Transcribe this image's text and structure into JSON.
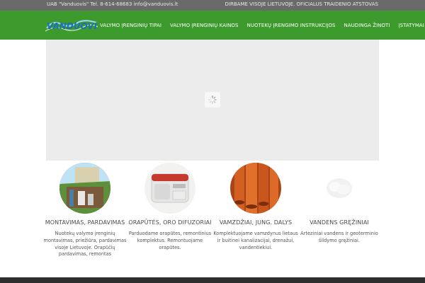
{
  "topbar": {
    "contact": "UAB \"Vanduovis\" Tel. 8-614-68683 info@vanduovis.lt",
    "tagline": "DIRBAME VISOJE LIETUVOJE. OFICIALUS TRAIDENIO ATSTOVAS"
  },
  "header": {
    "logo_text": "VANDUOVIS"
  },
  "nav": [
    "VALYMO ĮRENGINIŲ TIPAI",
    "VALYMO ĮRENGINIŲ KAINOS",
    "NUOTEKŲ ĮRENGIMO INSTRUKCIJOS",
    "NAUDINGA ŽINOTI",
    "ĮSTATYMAI"
  ],
  "features": [
    {
      "title": "MONTAVIMAS, PARDAVIMAS",
      "desc": "Nuotekų valymo įrenginių montavimas, priežiūra, pardavimas visoje Lietuvoje. Orapūčių pardavimas, remontas"
    },
    {
      "title": "ORAPŪTĖS, ORO DIFUZORIAI",
      "desc": "Parduodame orapūtes, remontinius komplektus. Remontuojame orapūtes."
    },
    {
      "title": "VAMZDŽIAI, JUNG. DALYS",
      "desc": "Komplektuojame vamzdynus lietaus ir buitinei kanalizacijai, drenažui, vandentiekiui."
    },
    {
      "title": "VANDENS GRĘŽINIAI",
      "desc": "Arteziniai vandens ir geoterminio šildymo gręžiniai."
    }
  ],
  "colors": {
    "topbar": "#6a6a6a",
    "navbar": "#3c9b2c",
    "logo_blue": "#1d6fb8"
  }
}
